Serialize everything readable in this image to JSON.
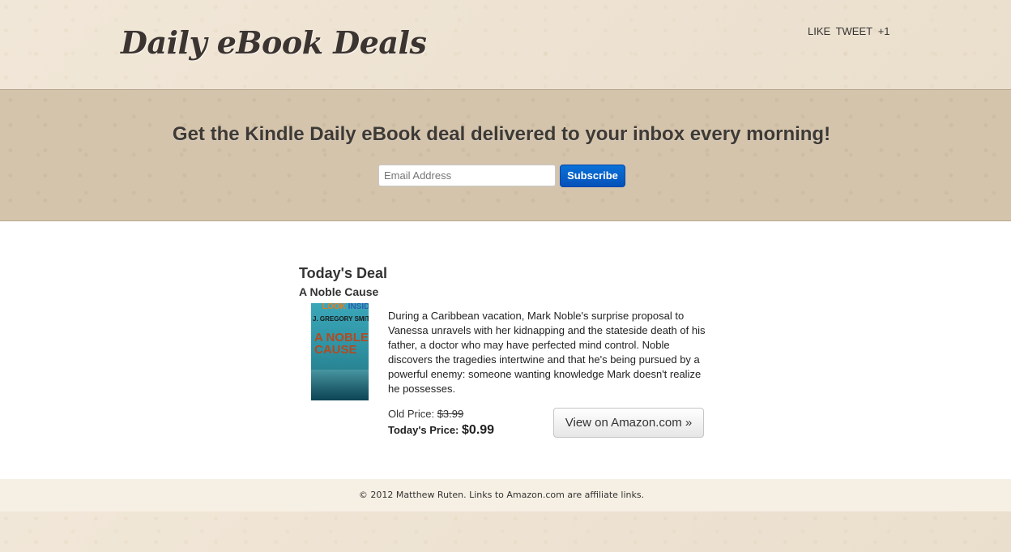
{
  "header": {
    "logo": "Daily eBook Deals",
    "social": [
      "LIKE",
      "TWEET",
      "+1"
    ]
  },
  "signup": {
    "headline": "Get the Kindle Daily eBook deal delivered to your inbox every morning!",
    "email_placeholder": "Email Address",
    "subscribe_label": "Subscribe",
    "button_color": "#0a5fc8"
  },
  "deal": {
    "heading": "Today's Deal",
    "book_title": "A Noble Cause",
    "cover": {
      "look_inside_prefix": "LOOK ",
      "look_inside_suffix": "INSIDE!",
      "author": "J. GREGORY SMITH",
      "title": "A NOBLE CAUSE"
    },
    "description": "During a Caribbean vacation, Mark Noble's surprise proposal to Vanessa unravels with her kidnapping and the stateside death of his father, a doctor who may have perfected mind control. Noble discovers the tragedies intertwine and that he's being pursued by a powerful enemy: someone wanting knowledge Mark doesn't realize he possesses.",
    "old_price_label": "Old Price:",
    "old_price": "$3.99",
    "today_price_label": "Today's Price:",
    "today_price": "$0.99",
    "amazon_button": "View on Amazon.com »"
  },
  "footer": {
    "text": "© 2012 Matthew Ruten. Links to Amazon.com are affiliate links."
  }
}
